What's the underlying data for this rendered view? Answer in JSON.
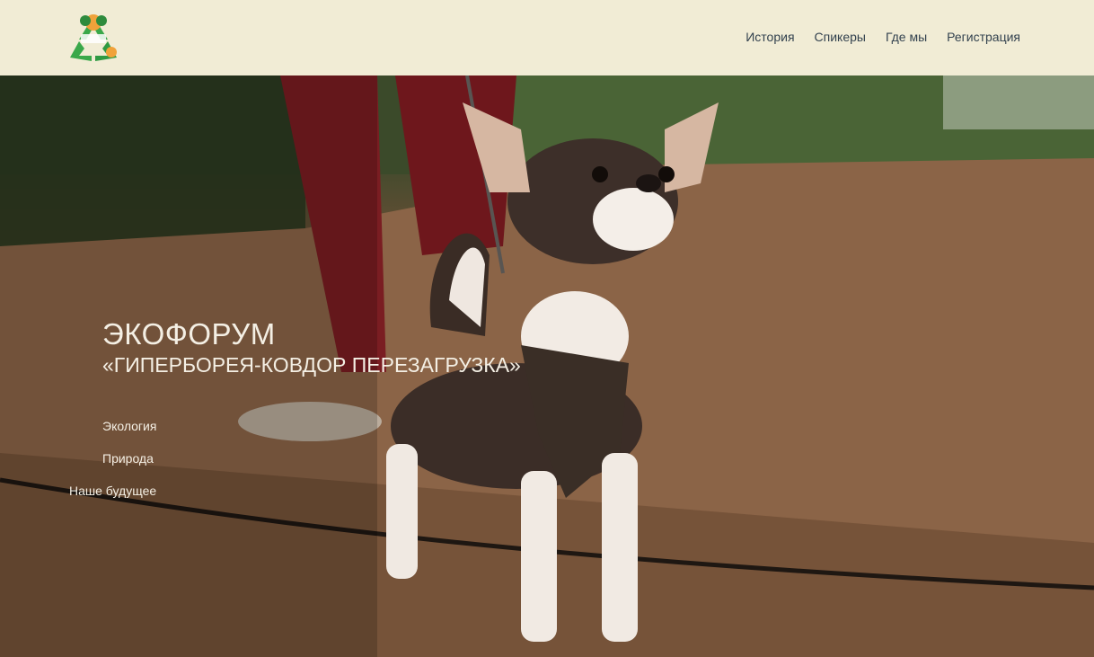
{
  "header": {
    "logo_icon": "eco-recycle-logo-icon",
    "nav": [
      {
        "label": "История"
      },
      {
        "label": "Спикеры"
      },
      {
        "label": "Где мы"
      },
      {
        "label": "Регистрация"
      }
    ]
  },
  "hero": {
    "title": "ЭКОФОРУМ",
    "subtitle": "«ГИПЕРБОРЕЯ-КОВДОР ПЕРЕЗАГРУЗКА»",
    "tags": [
      "Экология",
      "Природа",
      "Наше будущее"
    ],
    "background": "photo-chihuahua-on-forest-path"
  },
  "colors": {
    "header_bg": "#f1ecd5",
    "nav_text": "#33424f",
    "hero_text": "#f4efe4",
    "logo_green": "#3aa84a",
    "logo_orange": "#f0a23a"
  }
}
